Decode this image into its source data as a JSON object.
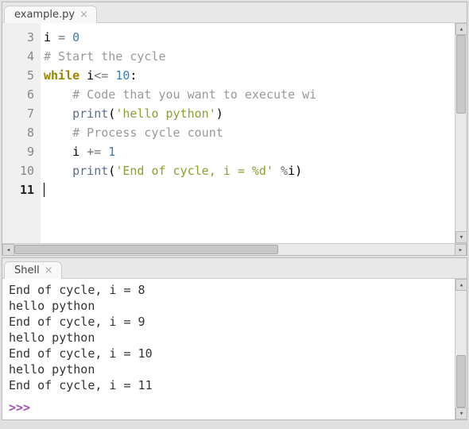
{
  "editor": {
    "tab_label": "example.py",
    "first_visible_line": 3,
    "current_line": 11,
    "lines": [
      {
        "n": 3,
        "tokens": [
          {
            "t": "i ",
            "c": ""
          },
          {
            "t": "=",
            "c": "op"
          },
          {
            "t": " ",
            "c": ""
          },
          {
            "t": "0",
            "c": "num"
          }
        ]
      },
      {
        "n": 4,
        "tokens": [
          {
            "t": "# Start the cycle",
            "c": "cmt"
          }
        ]
      },
      {
        "n": 5,
        "tokens": [
          {
            "t": "while",
            "c": "kw"
          },
          {
            "t": " i",
            "c": ""
          },
          {
            "t": "<=",
            "c": "op"
          },
          {
            "t": " ",
            "c": ""
          },
          {
            "t": "10",
            "c": "num"
          },
          {
            "t": ":",
            "c": ""
          }
        ]
      },
      {
        "n": 6,
        "tokens": [
          {
            "t": "    ",
            "c": ""
          },
          {
            "t": "# Code that you want to execute wi",
            "c": "cmt"
          }
        ]
      },
      {
        "n": 7,
        "tokens": [
          {
            "t": "    ",
            "c": ""
          },
          {
            "t": "print",
            "c": "fn"
          },
          {
            "t": "(",
            "c": ""
          },
          {
            "t": "'hello python'",
            "c": "str"
          },
          {
            "t": ")",
            "c": ""
          }
        ]
      },
      {
        "n": 8,
        "tokens": [
          {
            "t": "    ",
            "c": ""
          },
          {
            "t": "# Process cycle count",
            "c": "cmt"
          }
        ]
      },
      {
        "n": 9,
        "tokens": [
          {
            "t": "    i ",
            "c": ""
          },
          {
            "t": "+=",
            "c": "op"
          },
          {
            "t": " ",
            "c": ""
          },
          {
            "t": "1",
            "c": "num"
          }
        ]
      },
      {
        "n": 10,
        "tokens": [
          {
            "t": "    ",
            "c": ""
          },
          {
            "t": "print",
            "c": "fn"
          },
          {
            "t": "(",
            "c": ""
          },
          {
            "t": "'End of cycle, i = %d'",
            "c": "str"
          },
          {
            "t": " ",
            "c": ""
          },
          {
            "t": "%",
            "c": "op"
          },
          {
            "t": "i)",
            "c": ""
          }
        ]
      },
      {
        "n": 11,
        "tokens": []
      }
    ]
  },
  "shell": {
    "tab_label": "Shell",
    "output": [
      "End of cycle, i = 8",
      "hello python",
      "End of cycle, i = 9",
      "hello python",
      "End of cycle, i = 10",
      "hello python",
      "End of cycle, i = 11"
    ],
    "prompt": ">>>"
  }
}
